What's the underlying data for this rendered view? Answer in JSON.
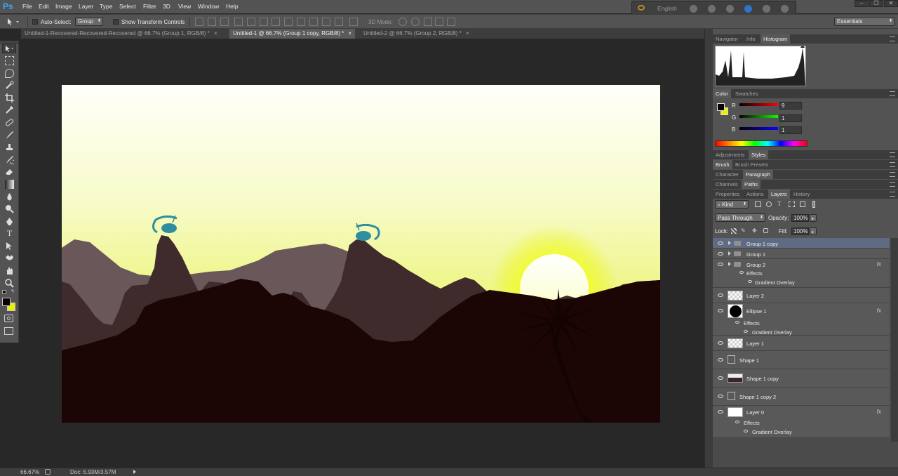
{
  "app": {
    "logo": "Ps",
    "menu": [
      "File",
      "Edit",
      "Image",
      "Layer",
      "Type",
      "Select",
      "Filter",
      "3D",
      "View",
      "Window",
      "Help"
    ],
    "language": "English",
    "window_controls": [
      "–",
      "❐",
      "✕"
    ]
  },
  "options_bar": {
    "auto_select_label": "Auto-Select:",
    "auto_select_value": "Group",
    "show_transform_label": "Show Transform Controls",
    "mode_3d_label": "3D Mode:",
    "workspace": "Essentials"
  },
  "tabs": [
    {
      "label": "Untitled-1-Recovered-Recovered-Recovered @ 66.7% (Group 1, RGB/8) *",
      "close": "×"
    },
    {
      "label": "Untitled-1 @ 66.7% (Group 1 copy, RGB/8) *",
      "close": "×"
    },
    {
      "label": "Untitled-2 @ 66.7% (Group 2, RGB/8) *",
      "close": "×"
    }
  ],
  "tools": [
    "move-tool",
    "marquee-tool",
    "lasso-tool",
    "quick-select-tool",
    "crop-tool",
    "eyedropper-tool",
    "healing-brush-tool",
    "brush-tool",
    "clone-stamp-tool",
    "history-brush-tool",
    "eraser-tool",
    "gradient-tool",
    "blur-tool",
    "dodge-tool",
    "pen-tool",
    "type-tool",
    "path-select-tool",
    "shape-tool",
    "hand-tool",
    "zoom-tool"
  ],
  "panels": {
    "group1": [
      "Navigator",
      "Info",
      "Histogram"
    ],
    "group2": [
      "Color",
      "Swatches"
    ],
    "group3": [
      "Adjustments",
      "Styles"
    ],
    "group4": [
      "Brush",
      "Brush Presets"
    ],
    "group5": [
      "Character",
      "Paragraph"
    ],
    "group6": [
      "Channels",
      "Paths"
    ],
    "group7": [
      "Properties",
      "Actions",
      "Layers",
      "History"
    ]
  },
  "color_panel": {
    "r_label": "R",
    "g_label": "G",
    "b_label": "B",
    "r": "9",
    "g": "1",
    "b": "1",
    "foreground": "#090101",
    "background": "#e8f000"
  },
  "layers_panel": {
    "kind_label": "Kind",
    "blend_mode": "Pass Through",
    "opacity_label": "Opacity:",
    "opacity": "100%",
    "lock_label": "Lock:",
    "fill_label": "Fill:",
    "fill": "100%",
    "layers": [
      {
        "name": "Group 1 copy",
        "type": "group",
        "selected": true
      },
      {
        "name": "Group 1",
        "type": "group"
      },
      {
        "name": "Group 2",
        "type": "group",
        "fx": "fx",
        "effects": [
          "Effects",
          "Gradient Overlay"
        ]
      },
      {
        "name": "Layer 2",
        "type": "pixel"
      },
      {
        "name": "Ellipse 1",
        "type": "shape",
        "fx": "fx",
        "effects": [
          "Effects",
          "Gradient Overlay"
        ]
      },
      {
        "name": "Layer 1",
        "type": "pixel"
      },
      {
        "name": "Shape 1",
        "type": "shape"
      },
      {
        "name": "Shape 1 copy",
        "type": "shape"
      },
      {
        "name": "Shape 1 copy 2",
        "type": "shape"
      },
      {
        "name": "Layer 0",
        "type": "fill",
        "fx": "fx",
        "effects": [
          "Effects",
          "Gradient Overlay"
        ]
      }
    ]
  },
  "status": {
    "zoom": "66.67%",
    "doc": "Doc: 5.93M/3.57M"
  },
  "colors": {
    "ui_bg": "#535353",
    "canvas_bg": "#282828",
    "sky_top": "#fffffa",
    "sky_bottom": "#e8f200",
    "ground": "#1c0505",
    "accent_blue": "#2e8ea0"
  }
}
